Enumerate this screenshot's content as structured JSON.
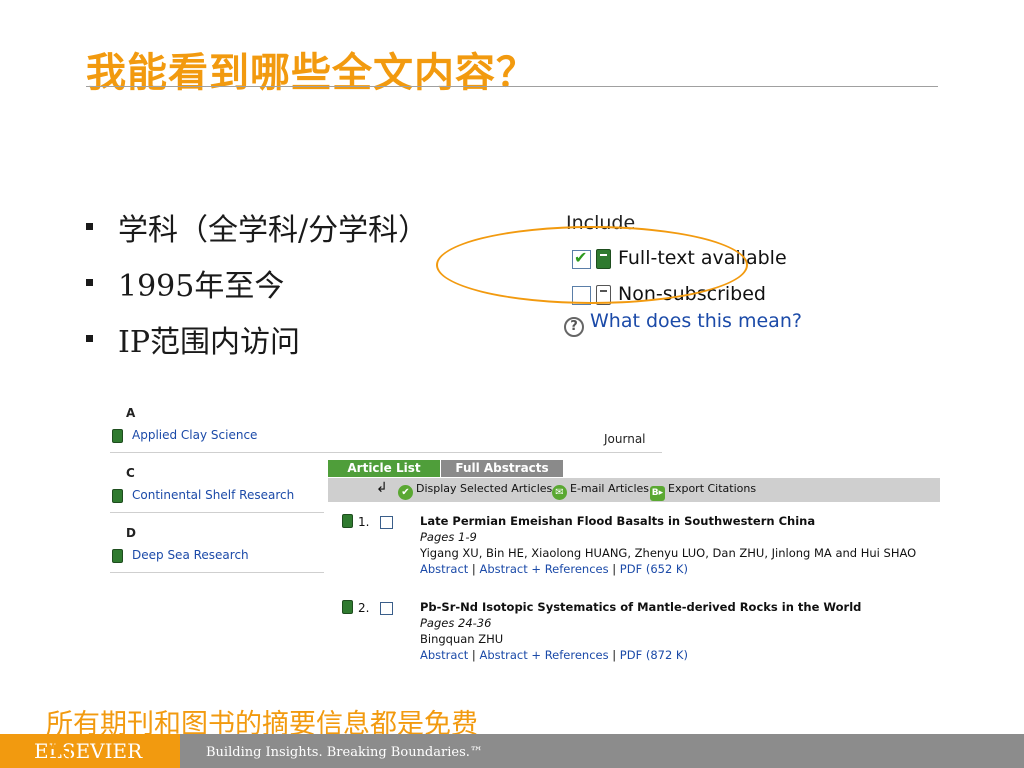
{
  "slide": {
    "title": "我能看到哪些全文内容？",
    "bullets": [
      "学科（全学科/分学科）",
      "1995年至今",
      "IP范围内访问"
    ],
    "footnote_line1": "所有期刊和图书的摘要信息都是免费",
    "footnote_line2": "的"
  },
  "include_panel": {
    "label": "Include",
    "options": [
      {
        "label": "Full-text available",
        "checked": true,
        "icon": "green-book-icon"
      },
      {
        "label": "Non-subscribed",
        "checked": false,
        "icon": "white-book-icon"
      }
    ],
    "help_link": "What does this mean?"
  },
  "journal_list": {
    "sections": [
      {
        "letter": "A",
        "name": "Applied Clay Science",
        "type": "Journal"
      },
      {
        "letter": "C",
        "name": "Continental Shelf Research"
      },
      {
        "letter": "D",
        "name": "Deep Sea Research"
      }
    ]
  },
  "results": {
    "tabs": [
      "Article List",
      "Full Abstracts"
    ],
    "toolbar": {
      "display_selected": "Display Selected Articles",
      "email": "E-mail Articles",
      "export": "Export Citations"
    },
    "articles": [
      {
        "num": "1.",
        "title": "Late Permian Emeishan Flood Basalts in Southwestern China",
        "pages": "Pages 1-9",
        "authors": "Yigang XU, Bin HE, Xiaolong HUANG, Zhenyu LUO, Dan ZHU, Jinlong MA and Hui SHAO",
        "link_abstract": "Abstract",
        "link_abstract_refs": "Abstract + References",
        "link_pdf": "PDF (652 K)"
      },
      {
        "num": "2.",
        "title": "Pb-Sr-Nd Isotopic Systematics of Mantle-derived Rocks in the World",
        "pages": "Pages 24-36",
        "authors": "Bingquan ZHU",
        "link_abstract": "Abstract",
        "link_abstract_refs": "Abstract + References",
        "link_pdf": "PDF (872 K)"
      }
    ]
  },
  "footer": {
    "brand": "ELSEVIER",
    "tagline": "Building Insights. Breaking Boundaries.™"
  },
  "colors": {
    "accent": "#F29A0F",
    "link": "#1b4aa8",
    "tab_active": "#4f9e3a",
    "book_green": "#2f7a2f"
  }
}
